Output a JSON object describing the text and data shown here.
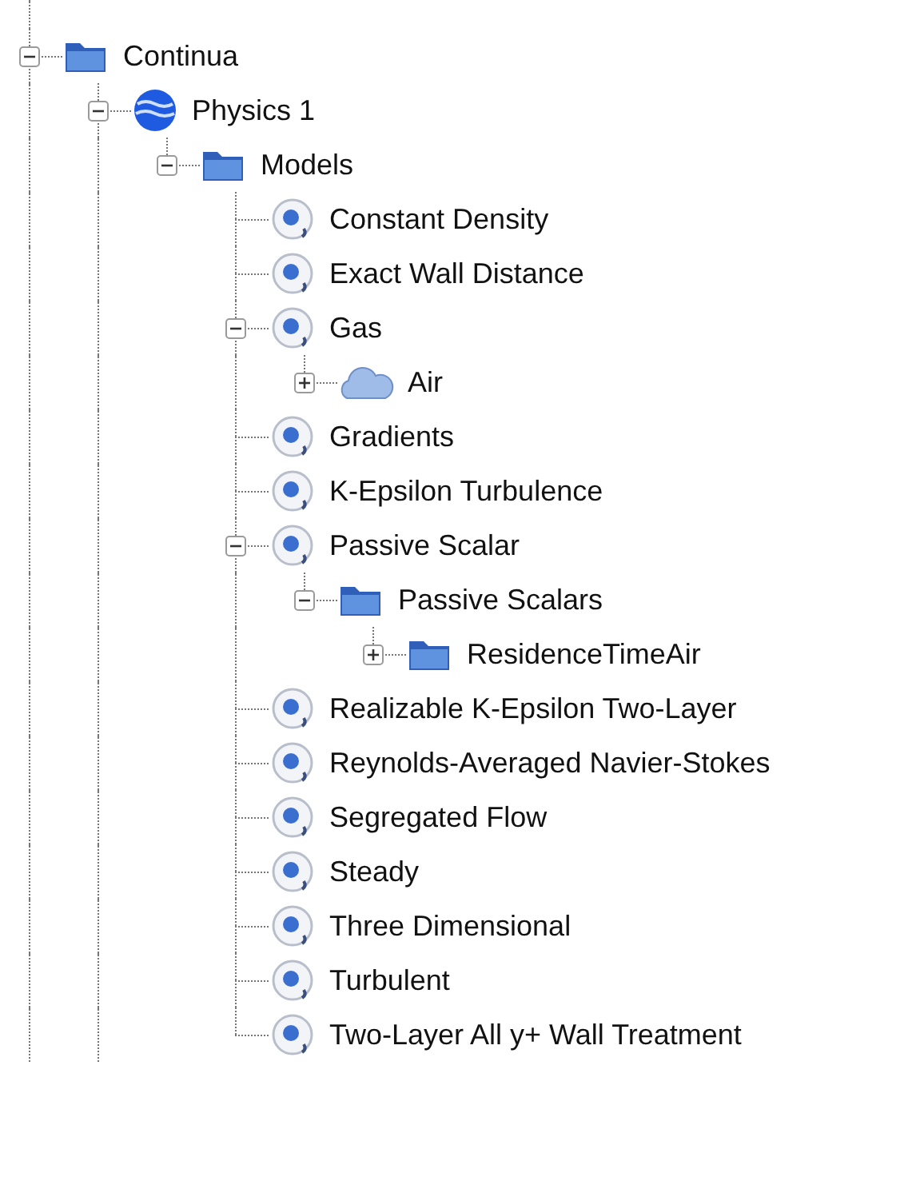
{
  "tree": [
    {
      "label": "Continua",
      "kind": "folder",
      "expanded": true,
      "more_above": true,
      "more_below": true,
      "children": [
        {
          "label": "Physics 1",
          "kind": "physics",
          "expanded": true,
          "more_below": true,
          "children": [
            {
              "label": "Models",
              "kind": "folder",
              "expanded": true,
              "children": [
                {
                  "label": "Constant Density",
                  "kind": "model"
                },
                {
                  "label": "Exact Wall Distance",
                  "kind": "model"
                },
                {
                  "label": "Gas",
                  "kind": "model",
                  "expanded": true,
                  "children": [
                    {
                      "label": "Air",
                      "kind": "cloud",
                      "expanded": false
                    }
                  ]
                },
                {
                  "label": "Gradients",
                  "kind": "model"
                },
                {
                  "label": "K-Epsilon Turbulence",
                  "kind": "model"
                },
                {
                  "label": "Passive Scalar",
                  "kind": "model",
                  "expanded": true,
                  "children": [
                    {
                      "label": "Passive Scalars",
                      "kind": "folder",
                      "expanded": true,
                      "children": [
                        {
                          "label": "ResidenceTimeAir",
                          "kind": "folder",
                          "expanded": false
                        }
                      ]
                    }
                  ]
                },
                {
                  "label": "Realizable K-Epsilon Two-Layer",
                  "kind": "model"
                },
                {
                  "label": "Reynolds-Averaged Navier-Stokes",
                  "kind": "model"
                },
                {
                  "label": "Segregated Flow",
                  "kind": "model"
                },
                {
                  "label": "Steady",
                  "kind": "model"
                },
                {
                  "label": "Three Dimensional",
                  "kind": "model"
                },
                {
                  "label": "Turbulent",
                  "kind": "model"
                },
                {
                  "label": "Two-Layer All y+ Wall Treatment",
                  "kind": "model"
                }
              ]
            }
          ]
        }
      ]
    }
  ]
}
